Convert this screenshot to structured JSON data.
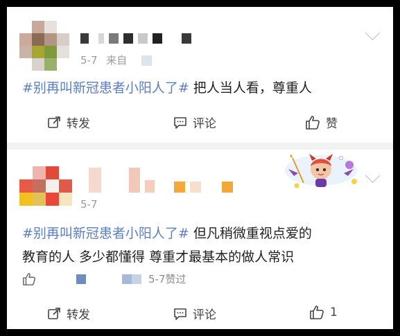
{
  "colors": {
    "tag": "#5b7fc2",
    "text": "#222222",
    "meta": "#9a9a9a",
    "separator": "#f2f2f2"
  },
  "posts": [
    {
      "date": "5-7",
      "source_prefix": "来自",
      "hashtag": "#别再叫新冠患者小阳人了#",
      "text_line1": " 把人当人看，尊重人",
      "text_line2": "",
      "actions": {
        "repost": "转发",
        "comment": "评论",
        "like": "赞"
      }
    },
    {
      "date": "5-7",
      "hashtag": "#别再叫新冠患者小阳人了#",
      "text_line1": " 但凡稍微重视点爱的",
      "text_line2": "教育的人 多少都懂得 尊重才最基本的做人常识",
      "like_info": "5-7赞过",
      "actions": {
        "repost": "转发",
        "comment": "评论",
        "like": "1"
      }
    }
  ],
  "icons": [
    "chevron-down-icon",
    "share-icon",
    "comment-icon",
    "thumbs-up-icon",
    "devil-sticker-icon"
  ]
}
